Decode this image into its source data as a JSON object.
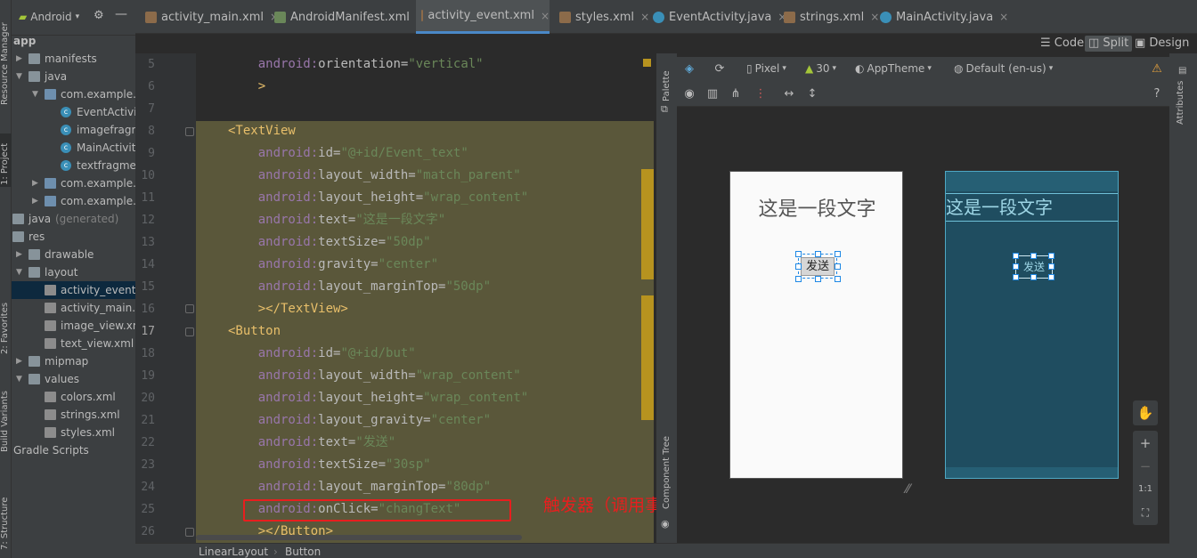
{
  "project_panel": {
    "selector_label": "Android",
    "tree": [
      {
        "label": "app",
        "indent": 1,
        "type": "root"
      },
      {
        "label": "manifests",
        "indent": 2,
        "type": "folder"
      },
      {
        "label": "java",
        "indent": 2,
        "type": "folder"
      },
      {
        "label": "com.example.frag",
        "indent": 3,
        "type": "folder"
      },
      {
        "label": "EventActivity",
        "indent": 4,
        "type": "class"
      },
      {
        "label": "imagefragmet",
        "indent": 4,
        "type": "class"
      },
      {
        "label": "MainActivity",
        "indent": 4,
        "type": "class"
      },
      {
        "label": "textfragment",
        "indent": 4,
        "type": "class"
      },
      {
        "label": "com.example.frag",
        "indent": 3,
        "type": "folder"
      },
      {
        "label": "com.example.frag",
        "indent": 3,
        "type": "folder"
      },
      {
        "label": "java",
        "suffix": "(generated)",
        "indent": 1,
        "type": "folder"
      },
      {
        "label": "res",
        "indent": 1,
        "type": "folder"
      },
      {
        "label": "drawable",
        "indent": 2,
        "type": "folder"
      },
      {
        "label": "layout",
        "indent": 2,
        "type": "folder"
      },
      {
        "label": "activity_event.x",
        "indent": 3,
        "type": "xml",
        "selected": true
      },
      {
        "label": "activity_main.x",
        "indent": 3,
        "type": "xml"
      },
      {
        "label": "image_view.xm",
        "indent": 3,
        "type": "xml"
      },
      {
        "label": "text_view.xml",
        "indent": 3,
        "type": "xml"
      },
      {
        "label": "mipmap",
        "indent": 2,
        "type": "folder"
      },
      {
        "label": "values",
        "indent": 2,
        "type": "folder"
      },
      {
        "label": "colors.xml",
        "indent": 3,
        "type": "xml"
      },
      {
        "label": "strings.xml",
        "indent": 3,
        "type": "xml"
      },
      {
        "label": "styles.xml",
        "indent": 3,
        "type": "xml"
      },
      {
        "label": "Gradle Scripts",
        "indent": 1,
        "type": "gradle"
      }
    ]
  },
  "side_tabs": {
    "resource_manager": "Resource Manager",
    "project": "1: Project",
    "favorites": "2: Favorites",
    "build_variants": "Build Variants",
    "structure": "7: Structure",
    "palette": "Palette",
    "component_tree": "Component Tree",
    "attributes": "Attributes"
  },
  "tabs": [
    {
      "label": "activity_main.xml",
      "kind": "xml"
    },
    {
      "label": "AndroidManifest.xml",
      "kind": "manifest"
    },
    {
      "label": "activity_event.xml",
      "kind": "xml",
      "active": true
    },
    {
      "label": "styles.xml",
      "kind": "xml"
    },
    {
      "label": "EventActivity.java",
      "kind": "java"
    },
    {
      "label": "strings.xml",
      "kind": "xml"
    },
    {
      "label": "MainActivity.java",
      "kind": "java"
    }
  ],
  "view_modes": {
    "code": "Code",
    "split": "Split",
    "design": "Design",
    "active": "Split"
  },
  "code_lines": [
    {
      "n": "5",
      "parts": [
        [
          "ns",
          "    android:"
        ],
        [
          "attr",
          "orientation="
        ],
        [
          "val",
          "\"vertical\""
        ]
      ]
    },
    {
      "n": "6",
      "parts": [
        [
          "tag",
          "    >"
        ]
      ]
    },
    {
      "n": "7",
      "parts": []
    },
    {
      "n": "8",
      "parts": [
        [
          "tag",
          "<TextView"
        ]
      ]
    },
    {
      "n": "9",
      "parts": [
        [
          "ns",
          "    android:"
        ],
        [
          "attr",
          "id="
        ],
        [
          "val",
          "\"@+id/Event_text\""
        ]
      ]
    },
    {
      "n": "10",
      "parts": [
        [
          "ns",
          "    android:"
        ],
        [
          "attr",
          "layout_width="
        ],
        [
          "val",
          "\"match_parent\""
        ]
      ]
    },
    {
      "n": "11",
      "parts": [
        [
          "ns",
          "    android:"
        ],
        [
          "attr",
          "layout_height="
        ],
        [
          "val",
          "\"wrap_content\""
        ]
      ]
    },
    {
      "n": "12",
      "parts": [
        [
          "ns",
          "    android:"
        ],
        [
          "attr",
          "text="
        ],
        [
          "val",
          "\"这是一段文字\""
        ]
      ]
    },
    {
      "n": "13",
      "parts": [
        [
          "ns",
          "    android:"
        ],
        [
          "attr",
          "textSize="
        ],
        [
          "val",
          "\"50dp\""
        ]
      ]
    },
    {
      "n": "14",
      "parts": [
        [
          "ns",
          "    android:"
        ],
        [
          "attr",
          "gravity="
        ],
        [
          "val",
          "\"center\""
        ]
      ]
    },
    {
      "n": "15",
      "parts": [
        [
          "ns",
          "    android:"
        ],
        [
          "attr",
          "layout_marginTop="
        ],
        [
          "val",
          "\"50dp\""
        ]
      ]
    },
    {
      "n": "16",
      "parts": [
        [
          "tag",
          "    ></TextView>"
        ]
      ]
    },
    {
      "n": "17",
      "parts": [
        [
          "tag",
          "<Button"
        ]
      ],
      "current": true
    },
    {
      "n": "18",
      "parts": [
        [
          "ns",
          "    android:"
        ],
        [
          "attr",
          "id="
        ],
        [
          "val",
          "\"@+id/but\""
        ]
      ]
    },
    {
      "n": "19",
      "parts": [
        [
          "ns",
          "    android:"
        ],
        [
          "attr",
          "layout_width="
        ],
        [
          "val",
          "\"wrap_content\""
        ]
      ]
    },
    {
      "n": "20",
      "parts": [
        [
          "ns",
          "    android:"
        ],
        [
          "attr",
          "layout_height="
        ],
        [
          "val",
          "\"wrap_content\""
        ]
      ]
    },
    {
      "n": "21",
      "parts": [
        [
          "ns",
          "    android:"
        ],
        [
          "attr",
          "layout_gravity="
        ],
        [
          "val",
          "\"center\""
        ]
      ]
    },
    {
      "n": "22",
      "parts": [
        [
          "ns",
          "    android:"
        ],
        [
          "attr",
          "text="
        ],
        [
          "val",
          "\"发送\""
        ]
      ]
    },
    {
      "n": "23",
      "parts": [
        [
          "ns",
          "    android:"
        ],
        [
          "attr",
          "textSize="
        ],
        [
          "val",
          "\"30sp\""
        ]
      ]
    },
    {
      "n": "24",
      "parts": [
        [
          "ns",
          "    android:"
        ],
        [
          "attr",
          "layout_marginTop="
        ],
        [
          "val",
          "\"80dp\""
        ]
      ]
    },
    {
      "n": "25",
      "parts": [
        [
          "ns",
          "    android:"
        ],
        [
          "attr",
          "onClick="
        ],
        [
          "val",
          "\"changText\""
        ]
      ]
    },
    {
      "n": "26",
      "parts": [
        [
          "tag",
          "    ></Button>"
        ]
      ]
    }
  ],
  "annotation": "触发器（调用事件）",
  "design_toolbar": {
    "device": "Pixel",
    "api": "30",
    "theme": "AppTheme",
    "locale": "Default (en-us)"
  },
  "preview": {
    "text": "这是一段文字",
    "button": "发送"
  },
  "zoom_controls": {
    "fit_label": "1:1"
  },
  "breadcrumb": [
    "LinearLayout",
    "Button"
  ],
  "colors": {
    "annotation_red": "#e81e1e",
    "selection_blue": "#1e88e5",
    "blueprint": "#1f4d60",
    "highlight": "#5a573a"
  }
}
